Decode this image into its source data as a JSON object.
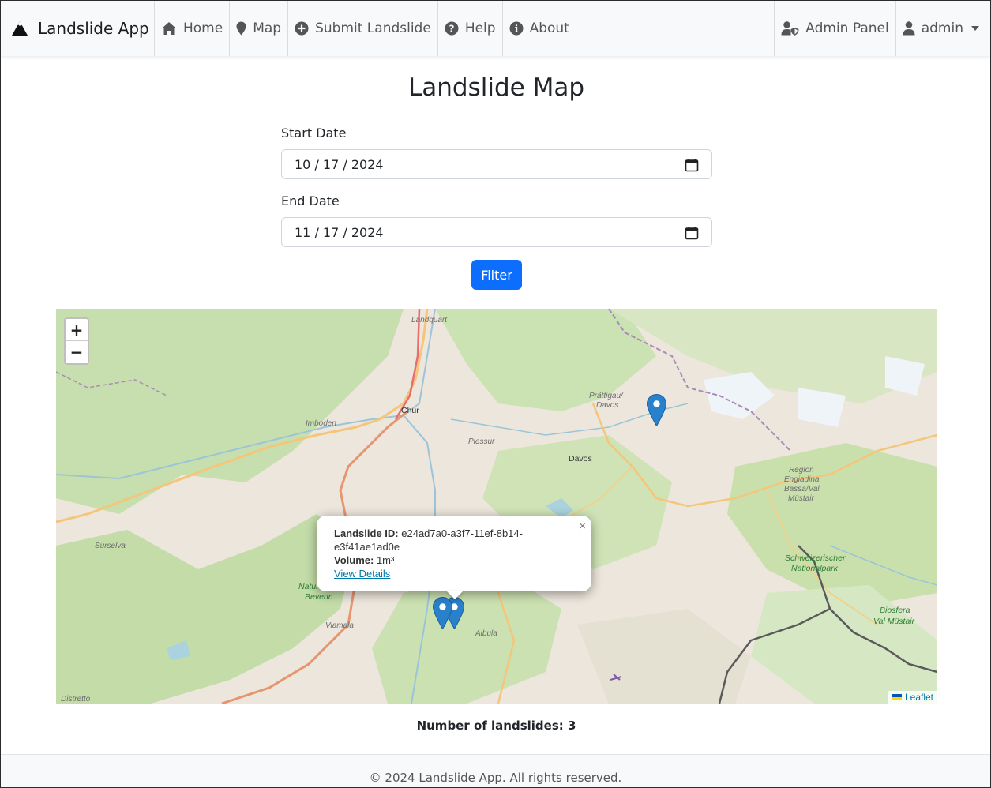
{
  "navbar": {
    "brand": "Landslide App",
    "items": [
      {
        "label": "Home",
        "icon": "home-icon"
      },
      {
        "label": "Map",
        "icon": "map-marker-icon"
      },
      {
        "label": "Submit Landslide",
        "icon": "plus-circle-icon"
      },
      {
        "label": "Help",
        "icon": "question-circle-icon"
      },
      {
        "label": "About",
        "icon": "info-circle-icon"
      }
    ],
    "admin_panel": "Admin Panel",
    "user": "admin"
  },
  "page_title": "Landslide Map",
  "filter_form": {
    "start_label": "Start Date",
    "start_value": "10 / 17 / 2024",
    "end_label": "End Date",
    "end_value": "11 / 17 / 2024",
    "button": "Filter"
  },
  "map": {
    "zoom_in": "+",
    "zoom_out": "−",
    "attribution": "Leaflet",
    "places": {
      "landquart": "Landquart",
      "chur": "Chur",
      "imboden": "Imboden",
      "plessur": "Plessur",
      "prattigau_1": "Prättigau/",
      "prattigau_2": "Davos",
      "davos": "Davos",
      "engiadina_1": "Region",
      "engiadina_2": "Engiadina",
      "engiadina_3": "Bassa/Val",
      "engiadina_4": "Müstair",
      "surselva": "Surselva",
      "naturpark_1": "Natur",
      "naturpark_2": "Beverin",
      "viamala": "Viamala",
      "albula": "Albula",
      "nationalpark_1": "Schweizerischer",
      "nationalpark_2": "Nationalpark",
      "biosfera_1": "Biosfera",
      "biosfera_2": "Val Müstair",
      "distretto": "Distretto"
    },
    "popup": {
      "id_label": "Landslide ID:",
      "id_value": "e24ad7a0-a3f7-11ef-8b14-e3f41ae1ad0e",
      "volume_label": "Volume:",
      "volume_value": "1m³",
      "link": "View Details",
      "close": "×"
    }
  },
  "count_text": "Number of landslides: 3",
  "footer": "© 2024 Landslide App. All rights reserved.",
  "colors": {
    "primary": "#0d6efd",
    "marker": "#2a81cb",
    "navbar_bg": "#f8f9fa"
  }
}
